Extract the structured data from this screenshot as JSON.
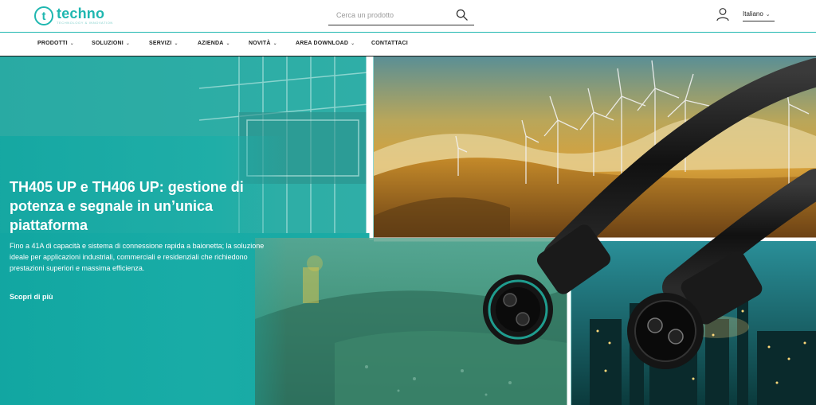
{
  "header": {
    "logo_letter": "t",
    "logo_word": "techno",
    "logo_tagline": "technology & innovation",
    "search_placeholder": "Cerca un prodotto",
    "language": "Italiano"
  },
  "nav": {
    "items": [
      {
        "label": "PRODOTTI",
        "dropdown": true
      },
      {
        "label": "SOLUZIONI",
        "dropdown": true
      },
      {
        "label": "SERVIZI",
        "dropdown": true
      },
      {
        "label": "AZIENDA",
        "dropdown": true
      },
      {
        "label": "NOVITÀ",
        "dropdown": true
      },
      {
        "label": "AREA DOWNLOAD",
        "dropdown": true
      },
      {
        "label": "CONTATTACI",
        "dropdown": false
      }
    ]
  },
  "hero": {
    "title": "TH405 UP e TH406 UP: gestione di potenza e segnale in un’unica piattaforma",
    "description": "Fino a 41A di capacità e sistema di connessione rapida a baionetta; la soluzione ideale per applicazioni industriali, commerciali e residenziali che richiedono prestazioni superiori e massima efficienza.",
    "cta": "Scopri di più"
  },
  "icons": {
    "search": "search-icon",
    "user": "user-icon",
    "chevron": "chevron-down-icon"
  },
  "colors": {
    "accent": "#1fb7b0",
    "hero_teal": "#1fb0aa",
    "text_dark": "#222222"
  }
}
